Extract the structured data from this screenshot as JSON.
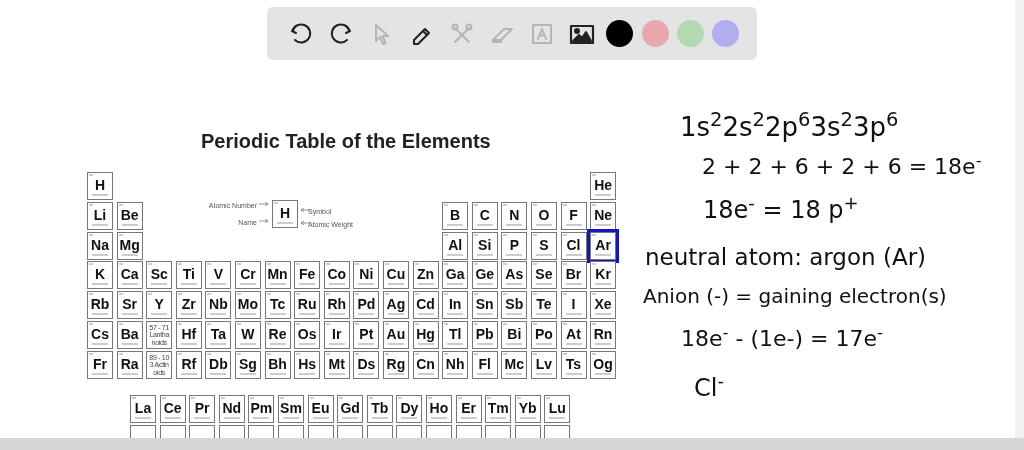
{
  "toolbar": {
    "tools": [
      {
        "kind": "undo",
        "disabled": false
      },
      {
        "kind": "redo",
        "disabled": false
      },
      {
        "kind": "pointer",
        "disabled": true
      },
      {
        "kind": "pencil",
        "disabled": false
      },
      {
        "kind": "tools",
        "disabled": true
      },
      {
        "kind": "eraser",
        "disabled": true
      },
      {
        "kind": "text",
        "disabled": true
      },
      {
        "kind": "image",
        "disabled": false
      }
    ],
    "colors": [
      {
        "color": "#000000"
      },
      {
        "color": "#eba7ae"
      },
      {
        "color": "#b3d9b0"
      },
      {
        "color": "#b1aef0"
      }
    ]
  },
  "periodic_table": {
    "title": "Periodic Table of the Elements",
    "legend": {
      "symbol": "H",
      "labels": [
        "Atomic Number",
        "Name",
        "Symbol",
        "Atomic Weight"
      ]
    },
    "rows": [
      {
        "left": [
          "H"
        ],
        "right": [
          "He"
        ]
      },
      {
        "left": [
          "Li",
          "Be"
        ],
        "right": [
          "B",
          "C",
          "N",
          "O",
          "F",
          "Ne"
        ]
      },
      {
        "left": [
          "Na",
          "Mg"
        ],
        "right": [
          "Al",
          "Si",
          "P",
          "S",
          "Cl",
          {
            "symbol": "Ar",
            "highlighted": true
          }
        ]
      },
      {
        "left": [
          "K",
          "Ca",
          "Sc",
          "Ti",
          "V",
          "Cr",
          "Mn",
          "Fe",
          "Co",
          "Ni",
          "Cu",
          "Zn",
          "Ga",
          "Ge",
          "As",
          "Se",
          "Br",
          "Kr"
        ],
        "right": []
      },
      {
        "left": [
          "Rb",
          "Sr",
          "Y",
          "Zr",
          "Nb",
          "Mo",
          "Tc",
          "Ru",
          "Rh",
          "Pd",
          "Ag",
          "Cd",
          "In",
          "Sn",
          "Sb",
          "Te",
          "I",
          "Xe"
        ],
        "right": []
      },
      {
        "left": [
          "Cs",
          "Ba",
          "57 - 71 Lanthanoids",
          "Hf",
          "Ta",
          "W",
          "Re",
          "Os",
          "Ir",
          "Pt",
          "Au",
          "Hg",
          "Tl",
          "Pb",
          "Bi",
          "Po",
          "At",
          "Rn"
        ],
        "right": []
      },
      {
        "left": [
          "Fr",
          "Ra",
          "89 - 103 Actinoids",
          "Rf",
          "Db",
          "Sg",
          "Bh",
          "Hs",
          "Mt",
          "Ds",
          "Rg",
          "Cn",
          "Nh",
          "Fl",
          "Mc",
          "Lv",
          "Ts",
          "Og"
        ],
        "right": []
      }
    ],
    "series": [
      [
        "La",
        "Ce",
        "Pr",
        "Nd",
        "Pm",
        "Sm",
        "Eu",
        "Gd",
        "Tb",
        "Dy",
        "Ho",
        "Er",
        "Tm",
        "Yb",
        "Lu"
      ]
    ]
  },
  "notes": [
    "1s$^{2}$2s$^{2}$2p$^{6}$3s$^{2}$3p$^{6}$",
    "2 + 2 + 6 + 2 + 6 = 18e$^{-}$",
    "18e$^{-}$ = 18 p$^{+}$",
    "neutral atom: argon (Ar)",
    "Anion (-) = gaining electron(s)",
    "18e$^{-}$ - (1e-) = 17e$^{-}$",
    "Cl$^{-}$"
  ]
}
